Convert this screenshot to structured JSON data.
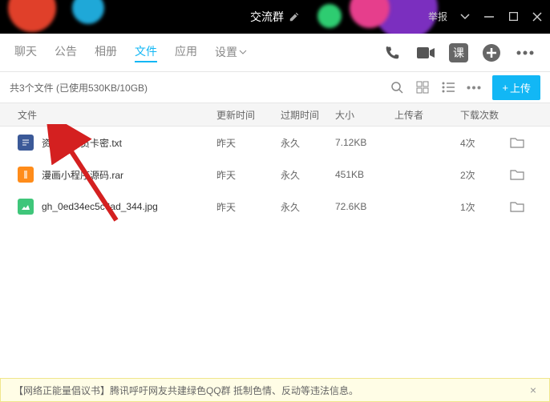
{
  "titlebar": {
    "title": "交流群",
    "report": "举报"
  },
  "tabs": {
    "chat": "聊天",
    "announce": "公告",
    "album": "相册",
    "files": "文件",
    "apps": "应用",
    "settings": "设置"
  },
  "tools": {
    "lesson": "课"
  },
  "subbar": {
    "summary": "共3个文件 (已使用530KB/10GB)",
    "upload": "上传"
  },
  "columns": {
    "file": "文件",
    "time": "更新时间",
    "expire": "过期时间",
    "size": "大小",
    "uploader": "上传者",
    "downloads": "下载次数"
  },
  "files": [
    {
      "name": "资源站会员卡密.txt",
      "time": "昨天",
      "expire": "永久",
      "size": "7.12KB",
      "downloads": "4次"
    },
    {
      "name": "漫画小程序源码.rar",
      "time": "昨天",
      "expire": "永久",
      "size": "451KB",
      "downloads": "2次"
    },
    {
      "name": "gh_0ed34ec5c6ad_344.jpg",
      "time": "昨天",
      "expire": "永久",
      "size": "72.6KB",
      "downloads": "1次"
    }
  ],
  "footer": {
    "text": "【网络正能量倡议书】腾讯呼吁网友共建绿色QQ群 抵制色情、反动等违法信息。"
  }
}
